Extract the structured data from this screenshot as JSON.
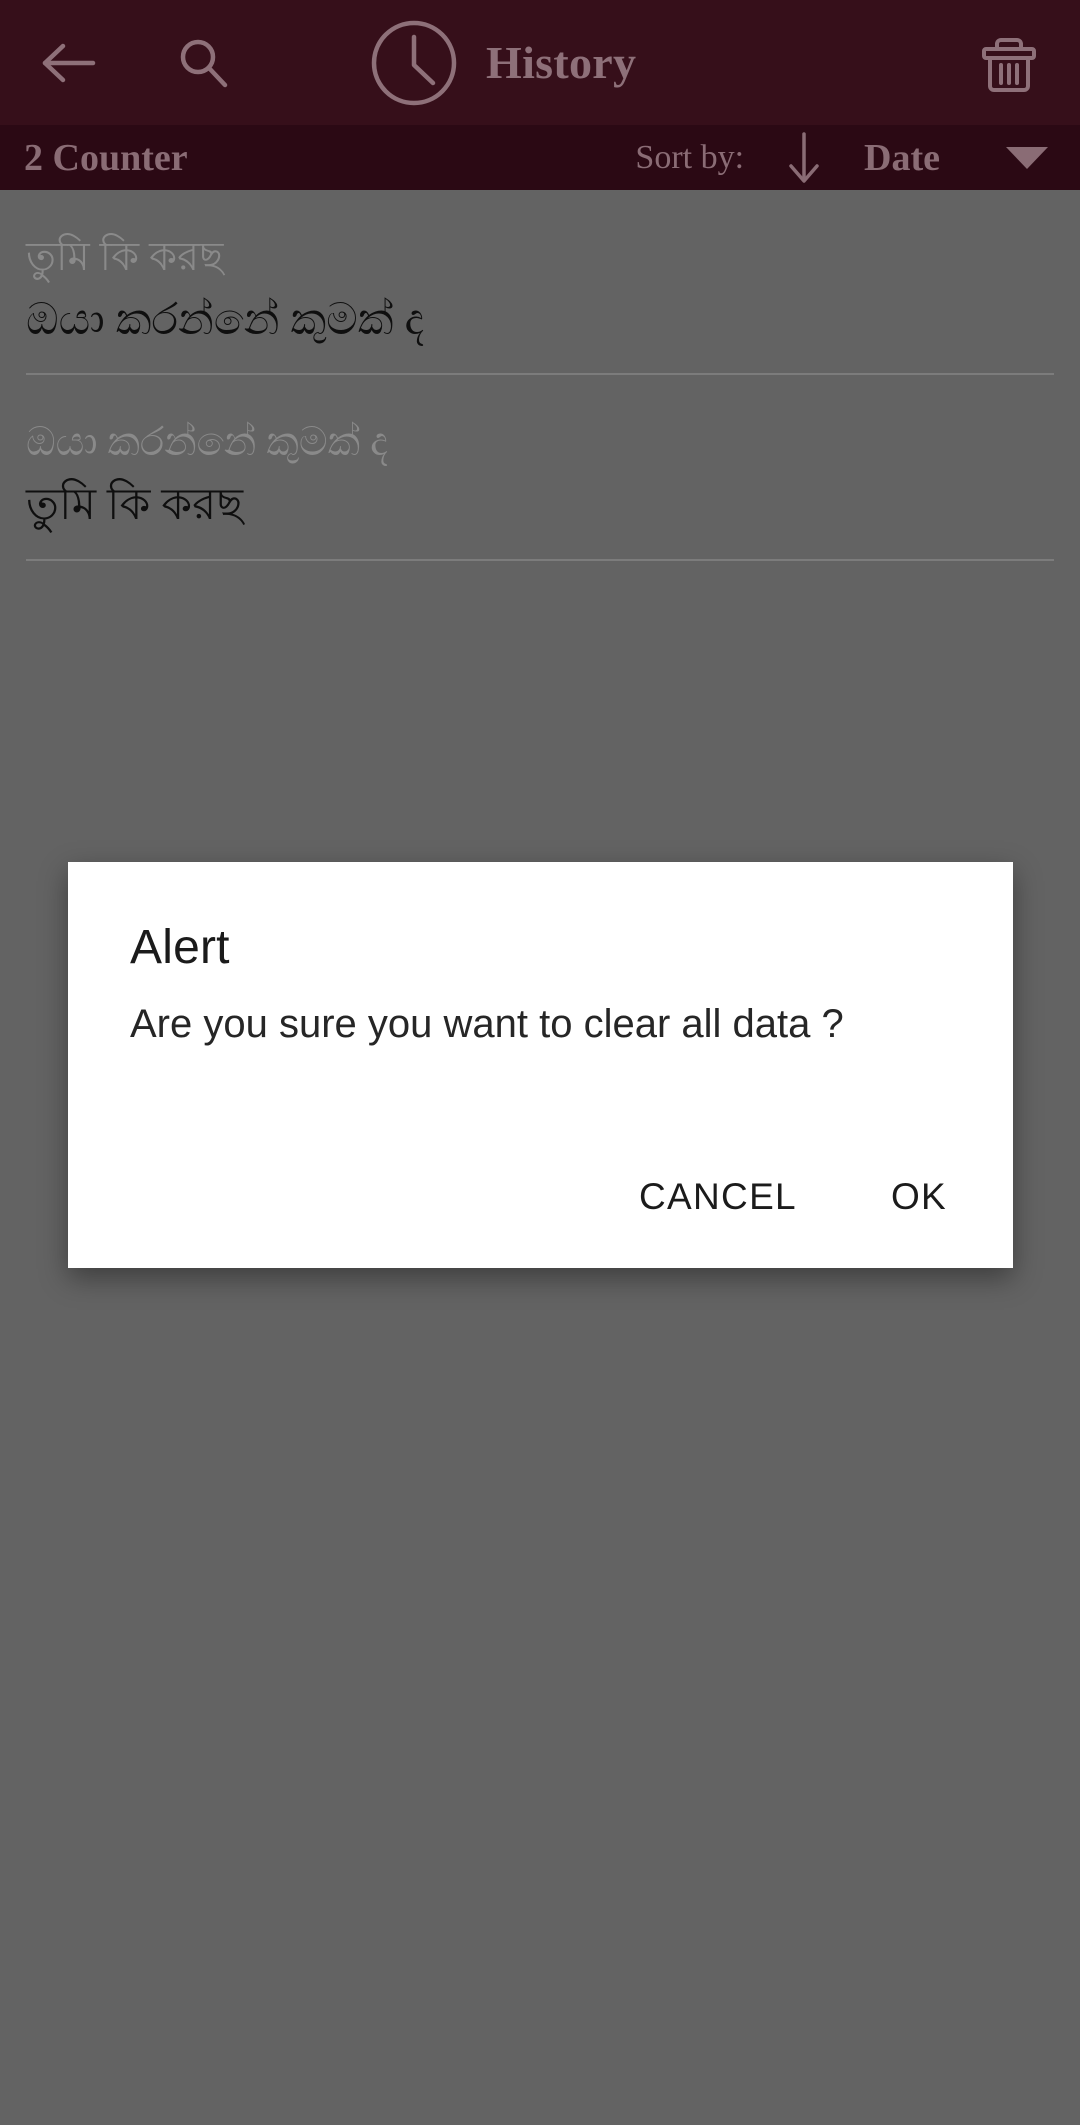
{
  "app_bar": {
    "title": "History",
    "back_icon": "arrow-left-icon",
    "search_icon": "search-icon",
    "clock_icon": "clock-icon",
    "delete_icon": "trash-icon",
    "background_color": "#360F1A",
    "foreground_color": "#8E7079"
  },
  "sub_bar": {
    "counter_label": "2 Counter",
    "sort_by_label": "Sort by:",
    "sort_direction_icon": "arrow-down-icon",
    "sort_field_label": "Date",
    "dropdown_icon": "caret-down-icon",
    "background_color": "#2B0914",
    "foreground_color": "#8A6C75"
  },
  "history": {
    "items": [
      {
        "source_text": "তুমি কি করছ",
        "target_text": "ඔයා කරන්නේ කුමක් ද"
      },
      {
        "source_text": "ඔයා කරන්නේ කුමක් ද",
        "target_text": "তুমি কি করছ"
      }
    ]
  },
  "dialog": {
    "title": "Alert",
    "message": "Are you sure you want to clear all data ?",
    "cancel_label": "CANCEL",
    "ok_label": "OK",
    "background_color": "#FFFFFF"
  },
  "page": {
    "scrim_color": "#636363"
  }
}
